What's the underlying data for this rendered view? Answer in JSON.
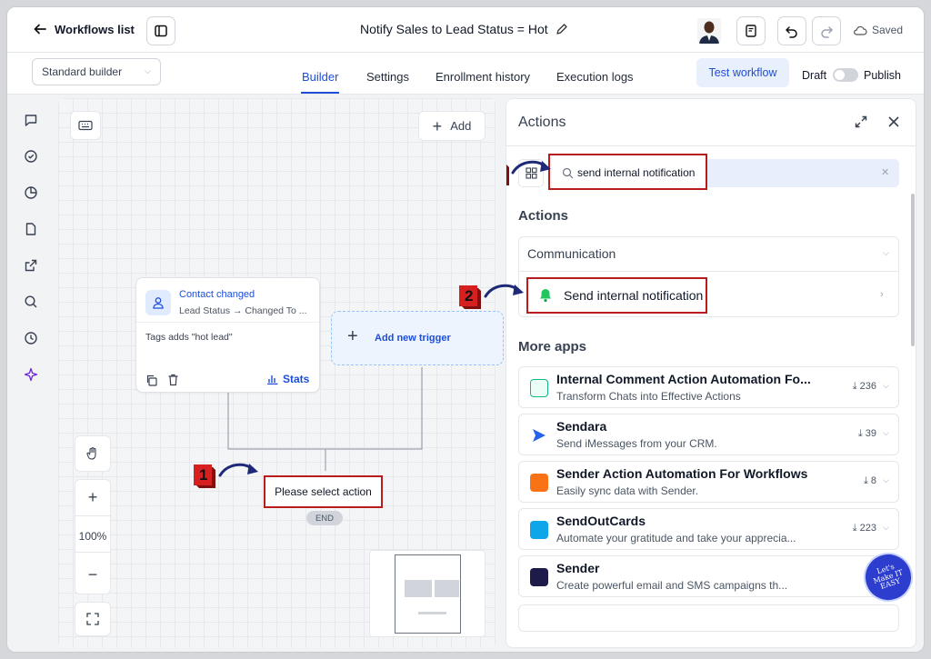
{
  "header": {
    "back_label": "Workflows list",
    "workflow_title": "Notify Sales to Lead Status = Hot",
    "saved_label": "Saved"
  },
  "subbar": {
    "builder_select": "Standard builder",
    "tabs": [
      "Builder",
      "Settings",
      "Enrollment history",
      "Execution logs"
    ],
    "test_button": "Test workflow",
    "draft_label": "Draft",
    "publish_label": "Publish"
  },
  "canvas": {
    "add_label": "Add",
    "trigger": {
      "title": "Contact changed",
      "subtitle": "Lead Status → Changed To ...",
      "filter": "Tags adds \"hot lead\"",
      "stats_label": "Stats"
    },
    "add_trigger_label": "Add new trigger",
    "action_label": "Please select action",
    "end_label": "END",
    "zoom": "100%"
  },
  "annotations": {
    "step1": "1",
    "step2a": "2",
    "step2b": "2"
  },
  "panel": {
    "title": "Actions",
    "search_value": "send internal notification",
    "actions_heading": "Actions",
    "group_label": "Communication",
    "result_label": "Send internal notification",
    "more_apps_heading": "More apps",
    "apps": [
      {
        "name": "Internal Comment Action Automation Fo...",
        "desc": "Transform Chats into Effective Actions",
        "count": "236",
        "icon_color": "#10b981"
      },
      {
        "name": "Sendara",
        "desc": "Send iMessages from your CRM.",
        "count": "39",
        "icon_color": "#2563eb"
      },
      {
        "name": "Sender Action Automation For Workflows",
        "desc": "Easily sync data with Sender.",
        "count": "8",
        "icon_color": "#f97316"
      },
      {
        "name": "SendOutCards",
        "desc": "Automate your gratitude and take your apprecia...",
        "count": "223",
        "icon_color": "#0ea5e9"
      },
      {
        "name": "Sender",
        "desc": "Create powerful email and SMS campaigns th...",
        "count": "",
        "icon_color": "#1e1b4b"
      }
    ]
  },
  "watermark": "Let's Make IT EASY",
  "colors": {
    "accent": "#1d4ed8",
    "highlight_red": "#b91c1c",
    "badge_red": "#d61f1f",
    "arrow_navy": "#1e2a78"
  }
}
